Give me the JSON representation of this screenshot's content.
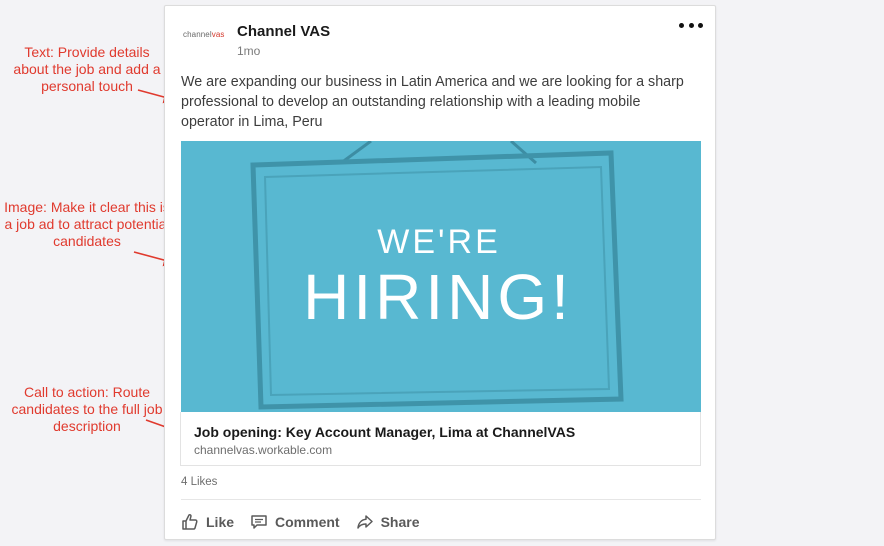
{
  "annotations": {
    "text_note": "Text: Provide details about the job and add a personal touch",
    "image_note": "Image: Make it clear this is a job ad to attract potential candidates",
    "cta_note": "Call to action: Route candidates to the full job description"
  },
  "post": {
    "company_name": "Channel VAS",
    "logo_text_a": "channel",
    "logo_text_b": "vas",
    "time_ago": "1mo",
    "body": "We are expanding our business in Latin America and we are looking for a sharp professional to develop an outstanding relationship with a leading mobile operator in Lima, Peru",
    "image": {
      "line1": "WE'RE",
      "line2": "HIRING!"
    },
    "link": {
      "title": "Job opening: Key Account Manager, Lima at ChannelVAS",
      "domain": "channelvas.workable.com"
    },
    "likes": "4 Likes",
    "actions": {
      "like": "Like",
      "comment": "Comment",
      "share": "Share"
    }
  },
  "colors": {
    "annotation": "#e03a2e",
    "image_bg": "#58b8d1",
    "sign_text": "#ffffff"
  },
  "icons": [
    "more-icon",
    "like-icon",
    "comment-icon",
    "share-icon"
  ]
}
